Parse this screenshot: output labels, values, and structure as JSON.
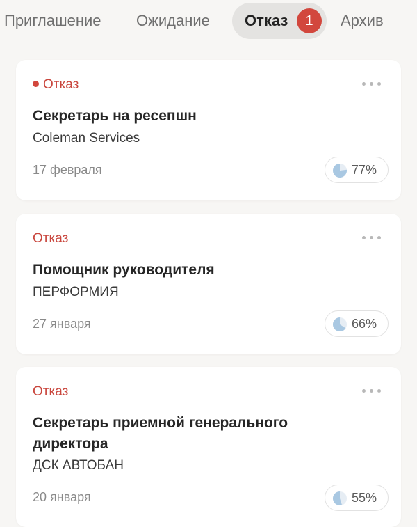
{
  "tabs": [
    {
      "label": "Приглашение",
      "active": false
    },
    {
      "label": "Ожидание",
      "active": false
    },
    {
      "label": "Отказ",
      "active": true,
      "badge": "1"
    },
    {
      "label": "Архив",
      "active": false
    }
  ],
  "colors": {
    "accent_red": "#d2473d",
    "status_text": "#c9463d",
    "pie_fill": "#a9c8e2",
    "pie_bg": "#e6edf4"
  },
  "cards": [
    {
      "status": "Отказ",
      "status_dot": true,
      "title": "Секретарь на ресепшн",
      "company": "Coleman Services",
      "date": "17 февраля",
      "match": "77%",
      "match_value": 0.77,
      "menu_icon": "more-horizontal-icon"
    },
    {
      "status": "Отказ",
      "status_dot": false,
      "title": "Помощник руководителя",
      "company": "ПЕРФОРМИЯ",
      "date": "27 января",
      "match": "66%",
      "match_value": 0.66,
      "menu_icon": "more-horizontal-icon"
    },
    {
      "status": "Отказ",
      "status_dot": false,
      "title": "Секретарь приемной генерального директора",
      "company": "ДСК АВТОБАН",
      "date": "20 января",
      "match": "55%",
      "match_value": 0.55,
      "menu_icon": "more-horizontal-icon"
    }
  ]
}
